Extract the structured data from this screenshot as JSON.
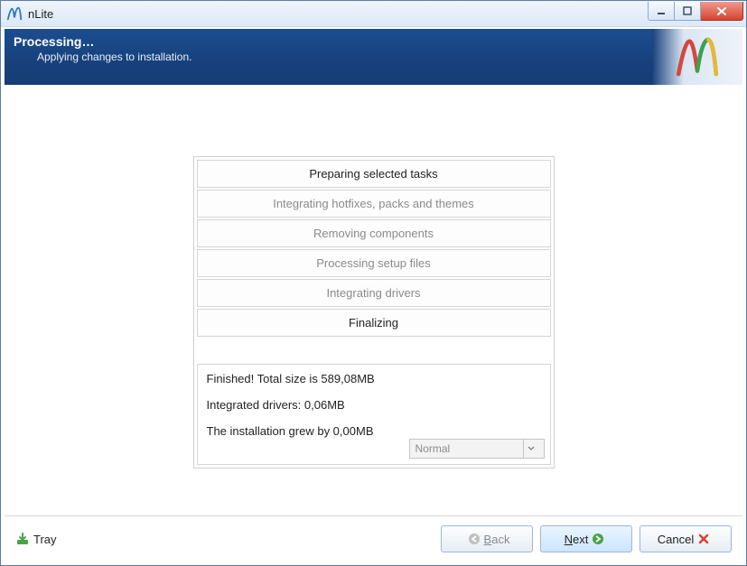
{
  "title": "nLite",
  "banner": {
    "heading": "Processing…",
    "sub": "Applying changes to installation."
  },
  "tasks": {
    "items": [
      {
        "label": "Preparing selected tasks",
        "active": true
      },
      {
        "label": "Integrating hotfixes, packs and themes",
        "active": false
      },
      {
        "label": "Removing components",
        "active": false
      },
      {
        "label": "Processing setup files",
        "active": false
      },
      {
        "label": "Integrating drivers",
        "active": false
      },
      {
        "label": "Finalizing",
        "active": true
      }
    ]
  },
  "log": {
    "lines": [
      "Finished! Total size is 589,08MB",
      "Integrated drivers: 0,06MB",
      "The installation grew by 0,00MB"
    ],
    "select_value": "Normal"
  },
  "buttons": {
    "tray": "Tray",
    "back": "Back",
    "next": "Next",
    "cancel": "Cancel"
  }
}
